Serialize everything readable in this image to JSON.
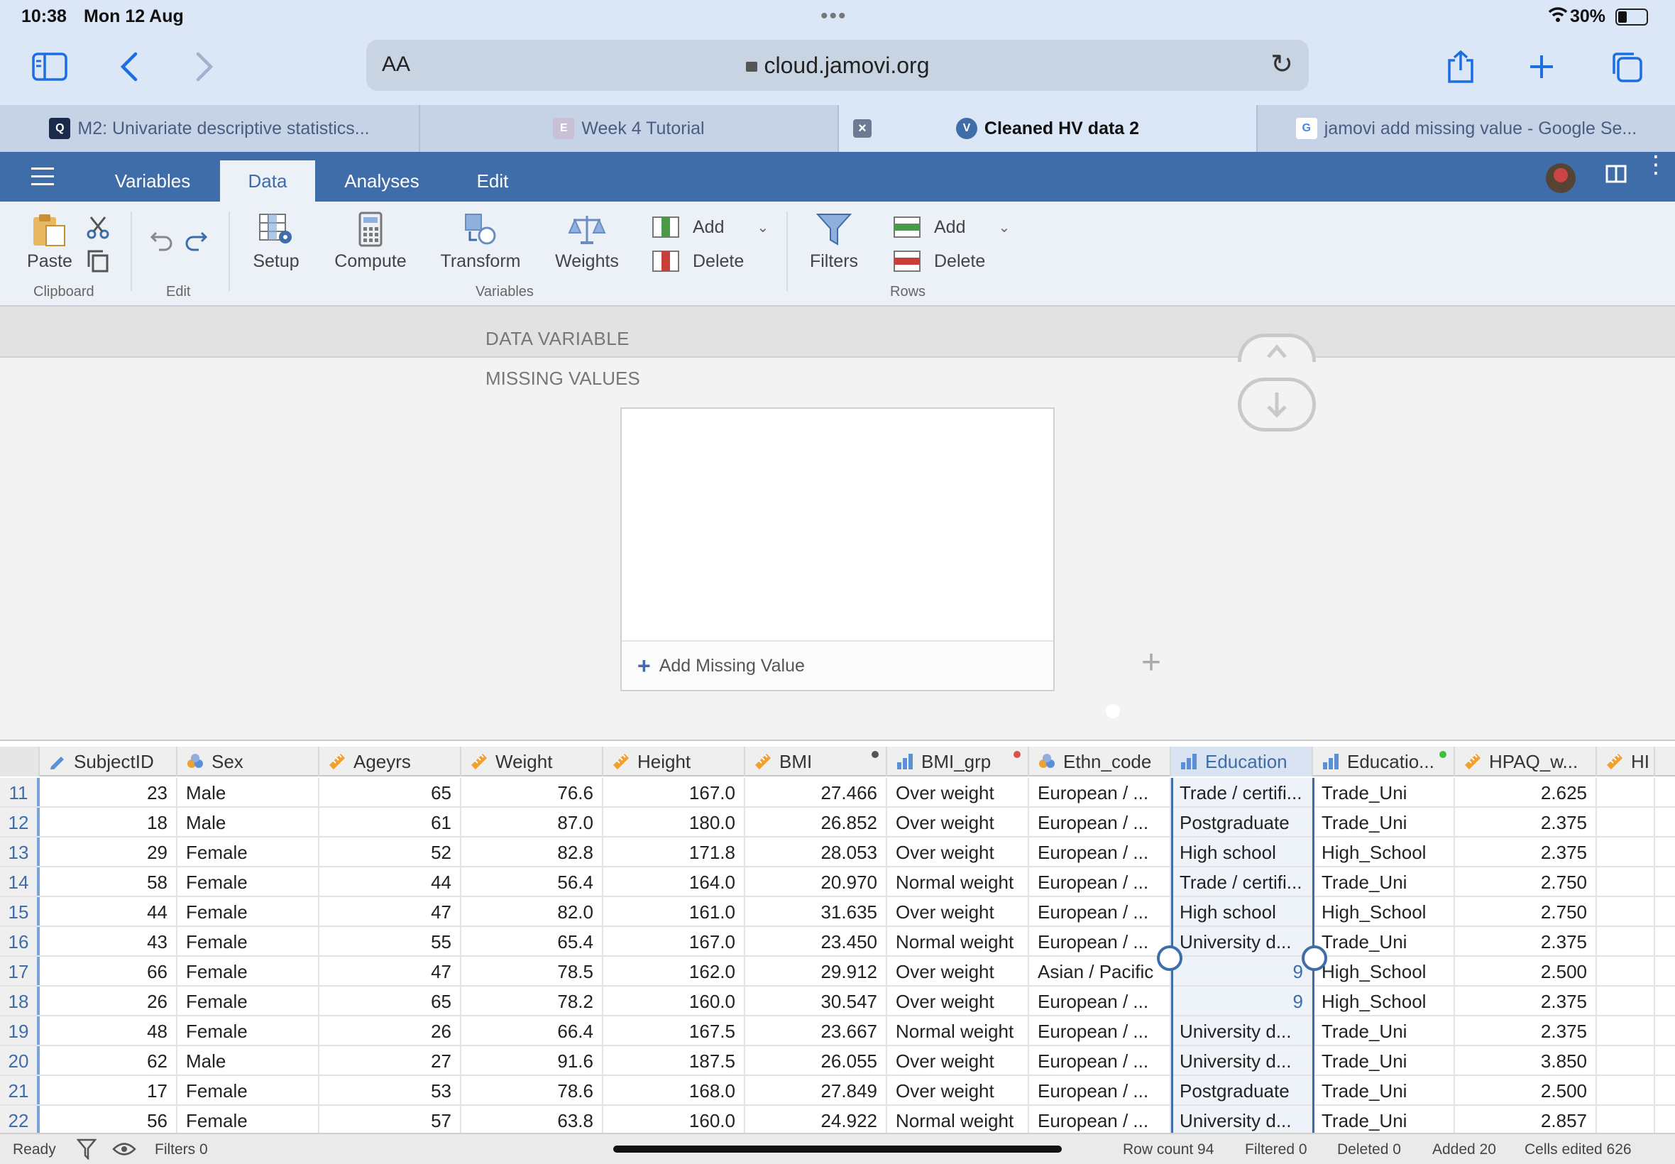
{
  "status": {
    "time": "10:38",
    "date": "Mon 12 Aug",
    "battery": "30%"
  },
  "browser": {
    "aa_label": "AA",
    "url": "cloud.jamovi.org",
    "tabs": [
      {
        "label": "M2: Univariate descriptive statistics...",
        "icon": "qut-icon"
      },
      {
        "label": "Week 4 Tutorial",
        "icon": "e-icon"
      },
      {
        "label": "Cleaned HV data 2",
        "icon": "jamovi-icon",
        "active": true
      },
      {
        "label": "jamovi add missing value - Google Se...",
        "icon": "google-icon"
      }
    ]
  },
  "jamovi": {
    "tabs": [
      "Variables",
      "Data",
      "Analyses",
      "Edit"
    ],
    "active_tab": "Data"
  },
  "ribbon": {
    "paste": "Paste",
    "clipboard": "Clipboard",
    "edit": "Edit",
    "setup": "Setup",
    "compute": "Compute",
    "transform": "Transform",
    "weights": "Weights",
    "var_add": "Add",
    "var_delete": "Delete",
    "variables": "Variables",
    "filters": "Filters",
    "row_add": "Add",
    "row_delete": "Delete",
    "rows": "Rows"
  },
  "setup": {
    "data_variable": "DATA VARIABLE",
    "missing_values": "MISSING VALUES",
    "add_missing": "Add Missing Value"
  },
  "grid": {
    "columns": [
      {
        "name": "SubjectID",
        "type": "id"
      },
      {
        "name": "Sex",
        "type": "nominal"
      },
      {
        "name": "Ageyrs",
        "type": "continuous"
      },
      {
        "name": "Weight",
        "type": "continuous"
      },
      {
        "name": "Height",
        "type": "continuous"
      },
      {
        "name": "BMI",
        "type": "continuous",
        "dot": "#555555"
      },
      {
        "name": "BMI_grp",
        "type": "ordinal",
        "dot": "#d9534f"
      },
      {
        "name": "Ethn_code",
        "type": "nominal"
      },
      {
        "name": "Education",
        "type": "ordinal",
        "selected": true
      },
      {
        "name": "Educatio...",
        "type": "ordinal",
        "dot": "#3cc13c"
      },
      {
        "name": "HPAQ_w...",
        "type": "continuous"
      },
      {
        "name": "HI",
        "type": "continuous"
      }
    ],
    "rows": [
      {
        "n": "11",
        "c": [
          "23",
          "Male",
          "65",
          "76.6",
          "167.0",
          "27.466",
          "Over weight",
          "European / ...",
          "Trade / certifi...",
          "Trade_Uni",
          "2.625",
          ""
        ]
      },
      {
        "n": "12",
        "c": [
          "18",
          "Male",
          "61",
          "87.0",
          "180.0",
          "26.852",
          "Over weight",
          "European / ...",
          "Postgraduate",
          "Trade_Uni",
          "2.375",
          ""
        ]
      },
      {
        "n": "13",
        "c": [
          "29",
          "Female",
          "52",
          "82.8",
          "171.8",
          "28.053",
          "Over weight",
          "European / ...",
          "High school",
          "High_School",
          "2.375",
          ""
        ]
      },
      {
        "n": "14",
        "c": [
          "58",
          "Female",
          "44",
          "56.4",
          "164.0",
          "20.970",
          "Normal weight",
          "European / ...",
          "Trade / certifi...",
          "Trade_Uni",
          "2.750",
          ""
        ]
      },
      {
        "n": "15",
        "c": [
          "44",
          "Female",
          "47",
          "82.0",
          "161.0",
          "31.635",
          "Over weight",
          "European / ...",
          "High school",
          "High_School",
          "2.750",
          ""
        ]
      },
      {
        "n": "16",
        "c": [
          "43",
          "Female",
          "55",
          "65.4",
          "167.0",
          "23.450",
          "Normal weight",
          "European / ...",
          "University d...",
          "Trade_Uni",
          "2.375",
          ""
        ]
      },
      {
        "n": "17",
        "c": [
          "66",
          "Female",
          "47",
          "78.5",
          "162.0",
          "29.912",
          "Over weight",
          "Asian / Pacific",
          "9",
          "High_School",
          "2.500",
          ""
        ]
      },
      {
        "n": "18",
        "c": [
          "26",
          "Female",
          "65",
          "78.2",
          "160.0",
          "30.547",
          "Over weight",
          "European / ...",
          "9",
          "High_School",
          "2.375",
          ""
        ]
      },
      {
        "n": "19",
        "c": [
          "48",
          "Female",
          "26",
          "66.4",
          "167.5",
          "23.667",
          "Normal weight",
          "European / ...",
          "University d...",
          "Trade_Uni",
          "2.375",
          ""
        ]
      },
      {
        "n": "20",
        "c": [
          "62",
          "Male",
          "27",
          "91.6",
          "187.5",
          "26.055",
          "Over weight",
          "European / ...",
          "University d...",
          "Trade_Uni",
          "3.850",
          ""
        ]
      },
      {
        "n": "21",
        "c": [
          "17",
          "Female",
          "53",
          "78.6",
          "168.0",
          "27.849",
          "Over weight",
          "European / ...",
          "Postgraduate",
          "Trade_Uni",
          "2.500",
          ""
        ]
      },
      {
        "n": "22",
        "c": [
          "56",
          "Female",
          "57",
          "63.8",
          "160.0",
          "24.922",
          "Normal weight",
          "European / ...",
          "University d...",
          "Trade_Uni",
          "2.857",
          ""
        ]
      }
    ]
  },
  "footer": {
    "ready": "Ready",
    "filters": "Filters 0",
    "row_count": "Row count 94",
    "filtered": "Filtered 0",
    "deleted": "Deleted 0",
    "added": "Added 20",
    "cells_edited": "Cells edited 626"
  },
  "colors": {
    "accent": "#3e6da9",
    "toolbar": "#ecf0f7",
    "chrome": "#dbe6f6"
  }
}
